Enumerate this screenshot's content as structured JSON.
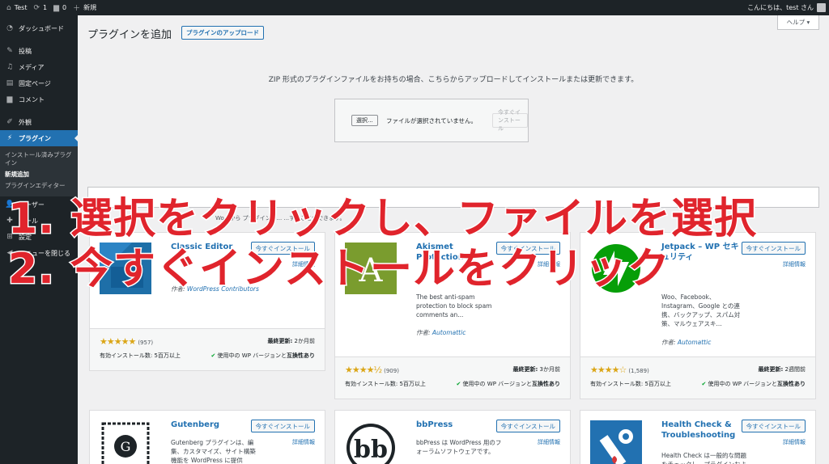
{
  "adminbar": {
    "site_name": "Test",
    "updates_count": "1",
    "comments_count": "0",
    "new_label": "新規",
    "greeting": "こんにちは、test さん"
  },
  "sidebar": {
    "items": [
      {
        "label": "ダッシュボード",
        "icon": "dashboard-icon"
      },
      {
        "label": "投稿",
        "icon": "pin-icon"
      },
      {
        "label": "メディア",
        "icon": "media-icon"
      },
      {
        "label": "固定ページ",
        "icon": "page-icon"
      },
      {
        "label": "コメント",
        "icon": "comment-icon"
      },
      {
        "label": "外観",
        "icon": "brush-icon"
      },
      {
        "label": "プラグイン",
        "icon": "plugin-icon"
      }
    ],
    "submenu": [
      "インストール済みプラグイン",
      "新規追加",
      "プラグインエディター"
    ],
    "extra": [
      "ユーザー",
      "ツール",
      "設定",
      "メニューを閉じる"
    ]
  },
  "main": {
    "help_label": "ヘルプ ▾",
    "title": "プラグインを追加",
    "upload_button": "プラグインのアップロード",
    "upload_description": "ZIP 形式のプラグインファイルをお持ちの場合、こちらからアップロードしてインストールまたは更新できます。",
    "choose_button": "選択...",
    "no_file_text": "ファイルが選択されていません。",
    "install_now_disabled": "今すぐインストール",
    "filter_text": "Wo...から プラグインを... ...することができます。"
  },
  "cards": [
    {
      "name": "Classic Editor",
      "install": "今すぐインストール",
      "details": "詳細情報",
      "desc": "",
      "author_label": "作者:",
      "author": "WordPress Contributors",
      "rating_count": "(957)",
      "updated_label": "最終更新:",
      "updated": "2か月前",
      "installs": "有効インストール数: 5百万以上",
      "compat_prefix": "使用中の WP バージョンと",
      "compat_bold": "互換性あり"
    },
    {
      "name": "Akismet Protection",
      "install": "今すぐインストール",
      "details": "詳細情報",
      "desc": "The best anti-spam protection to block spam comments an...",
      "author_label": "作者:",
      "author": "Automattic",
      "rating_count": "(909)",
      "updated_label": "最終更新:",
      "updated": "3か月前",
      "installs": "有効インストール数: 5百万以上",
      "compat_prefix": "使用中の WP バージョンと",
      "compat_bold": "互換性あり"
    },
    {
      "name": "Jetpack – WP セキュリティ",
      "install": "今すぐインストール",
      "details": "詳細情報",
      "desc": "Woo、Facebook、Instagram、Google との連携、バックアップ、スパム対策、マルウェアスキ...",
      "author_label": "作者:",
      "author": "Automattic",
      "rating_count": "(1,589)",
      "updated_label": "最終更新:",
      "updated": "2週間前",
      "installs": "有効インストール数: 5百万以上",
      "compat_prefix": "使用中の WP バージョンと",
      "compat_bold": "互換性あり"
    },
    {
      "name": "Gutenberg",
      "install": "今すぐインストール",
      "details": "詳細情報",
      "desc": "Gutenberg プラグインは、編集、カスタマイズ、サイト構築機能を WordPress に提供"
    },
    {
      "name": "bbPress",
      "install": "今すぐインストール",
      "details": "詳細情報",
      "desc": "bbPress は WordPress 用のフォーラムソフトウェアです。"
    },
    {
      "name": "Health Check & Troubleshooting",
      "install": "今すぐインストール",
      "details": "詳細情報",
      "desc": "Health Check は一般的な問題をチェックし、プラグインおよ"
    }
  ],
  "overlay": {
    "line1": "1. 選択をクリックし、ファイルを選択",
    "line2": "2. 今すぐインストールをクリック"
  }
}
